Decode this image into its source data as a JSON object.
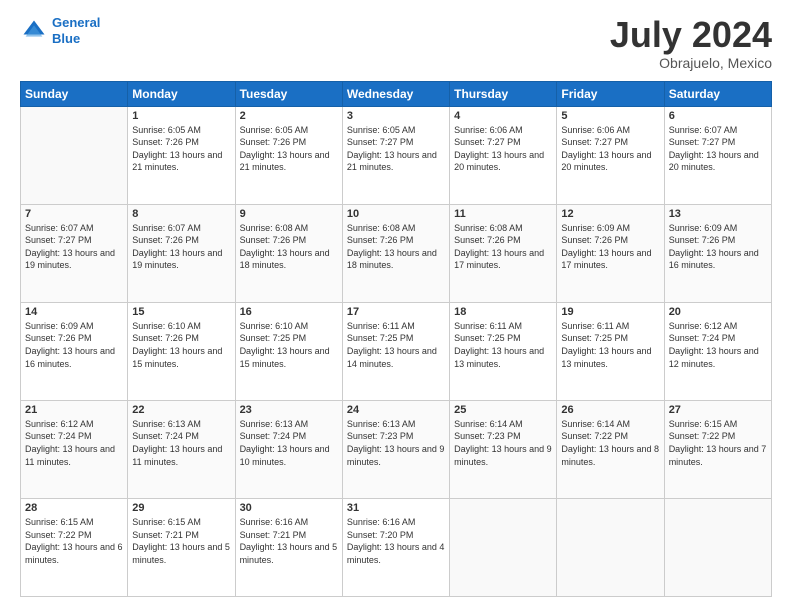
{
  "header": {
    "logo_line1": "General",
    "logo_line2": "Blue",
    "month_year": "July 2024",
    "location": "Obrajuelo, Mexico"
  },
  "weekdays": [
    "Sunday",
    "Monday",
    "Tuesday",
    "Wednesday",
    "Thursday",
    "Friday",
    "Saturday"
  ],
  "weeks": [
    [
      {
        "day": "",
        "empty": true
      },
      {
        "day": "1",
        "sunrise": "6:05 AM",
        "sunset": "7:26 PM",
        "daylight": "13 hours and 21 minutes."
      },
      {
        "day": "2",
        "sunrise": "6:05 AM",
        "sunset": "7:26 PM",
        "daylight": "13 hours and 21 minutes."
      },
      {
        "day": "3",
        "sunrise": "6:05 AM",
        "sunset": "7:27 PM",
        "daylight": "13 hours and 21 minutes."
      },
      {
        "day": "4",
        "sunrise": "6:06 AM",
        "sunset": "7:27 PM",
        "daylight": "13 hours and 20 minutes."
      },
      {
        "day": "5",
        "sunrise": "6:06 AM",
        "sunset": "7:27 PM",
        "daylight": "13 hours and 20 minutes."
      },
      {
        "day": "6",
        "sunrise": "6:07 AM",
        "sunset": "7:27 PM",
        "daylight": "13 hours and 20 minutes."
      }
    ],
    [
      {
        "day": "7",
        "sunrise": "6:07 AM",
        "sunset": "7:27 PM",
        "daylight": "13 hours and 19 minutes."
      },
      {
        "day": "8",
        "sunrise": "6:07 AM",
        "sunset": "7:26 PM",
        "daylight": "13 hours and 19 minutes."
      },
      {
        "day": "9",
        "sunrise": "6:08 AM",
        "sunset": "7:26 PM",
        "daylight": "13 hours and 18 minutes."
      },
      {
        "day": "10",
        "sunrise": "6:08 AM",
        "sunset": "7:26 PM",
        "daylight": "13 hours and 18 minutes."
      },
      {
        "day": "11",
        "sunrise": "6:08 AM",
        "sunset": "7:26 PM",
        "daylight": "13 hours and 17 minutes."
      },
      {
        "day": "12",
        "sunrise": "6:09 AM",
        "sunset": "7:26 PM",
        "daylight": "13 hours and 17 minutes."
      },
      {
        "day": "13",
        "sunrise": "6:09 AM",
        "sunset": "7:26 PM",
        "daylight": "13 hours and 16 minutes."
      }
    ],
    [
      {
        "day": "14",
        "sunrise": "6:09 AM",
        "sunset": "7:26 PM",
        "daylight": "13 hours and 16 minutes."
      },
      {
        "day": "15",
        "sunrise": "6:10 AM",
        "sunset": "7:26 PM",
        "daylight": "13 hours and 15 minutes."
      },
      {
        "day": "16",
        "sunrise": "6:10 AM",
        "sunset": "7:25 PM",
        "daylight": "13 hours and 15 minutes."
      },
      {
        "day": "17",
        "sunrise": "6:11 AM",
        "sunset": "7:25 PM",
        "daylight": "13 hours and 14 minutes."
      },
      {
        "day": "18",
        "sunrise": "6:11 AM",
        "sunset": "7:25 PM",
        "daylight": "13 hours and 13 minutes."
      },
      {
        "day": "19",
        "sunrise": "6:11 AM",
        "sunset": "7:25 PM",
        "daylight": "13 hours and 13 minutes."
      },
      {
        "day": "20",
        "sunrise": "6:12 AM",
        "sunset": "7:24 PM",
        "daylight": "13 hours and 12 minutes."
      }
    ],
    [
      {
        "day": "21",
        "sunrise": "6:12 AM",
        "sunset": "7:24 PM",
        "daylight": "13 hours and 11 minutes."
      },
      {
        "day": "22",
        "sunrise": "6:13 AM",
        "sunset": "7:24 PM",
        "daylight": "13 hours and 11 minutes."
      },
      {
        "day": "23",
        "sunrise": "6:13 AM",
        "sunset": "7:24 PM",
        "daylight": "13 hours and 10 minutes."
      },
      {
        "day": "24",
        "sunrise": "6:13 AM",
        "sunset": "7:23 PM",
        "daylight": "13 hours and 9 minutes."
      },
      {
        "day": "25",
        "sunrise": "6:14 AM",
        "sunset": "7:23 PM",
        "daylight": "13 hours and 9 minutes."
      },
      {
        "day": "26",
        "sunrise": "6:14 AM",
        "sunset": "7:22 PM",
        "daylight": "13 hours and 8 minutes."
      },
      {
        "day": "27",
        "sunrise": "6:15 AM",
        "sunset": "7:22 PM",
        "daylight": "13 hours and 7 minutes."
      }
    ],
    [
      {
        "day": "28",
        "sunrise": "6:15 AM",
        "sunset": "7:22 PM",
        "daylight": "13 hours and 6 minutes."
      },
      {
        "day": "29",
        "sunrise": "6:15 AM",
        "sunset": "7:21 PM",
        "daylight": "13 hours and 5 minutes."
      },
      {
        "day": "30",
        "sunrise": "6:16 AM",
        "sunset": "7:21 PM",
        "daylight": "13 hours and 5 minutes."
      },
      {
        "day": "31",
        "sunrise": "6:16 AM",
        "sunset": "7:20 PM",
        "daylight": "13 hours and 4 minutes."
      },
      {
        "day": "",
        "empty": true
      },
      {
        "day": "",
        "empty": true
      },
      {
        "day": "",
        "empty": true
      }
    ]
  ]
}
